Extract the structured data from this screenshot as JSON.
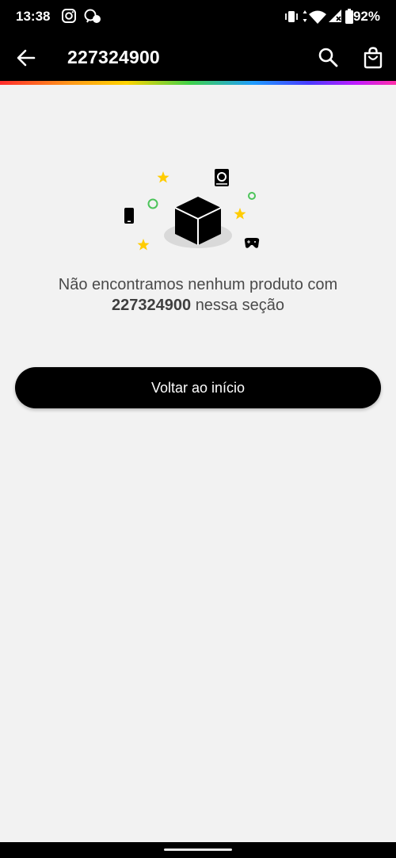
{
  "status_bar": {
    "time": "13:38",
    "battery": "92%",
    "icons": [
      "instagram-icon",
      "whatsapp-icon",
      "vibrate-icon",
      "wifi-icon",
      "signal-icon",
      "battery-icon"
    ]
  },
  "app_bar": {
    "title": "227324900",
    "icons": [
      "back-arrow-icon",
      "search-icon",
      "shopping-bag-icon"
    ]
  },
  "empty_state": {
    "message_prefix": "Não encontramos nenhum produto com",
    "query": "227324900",
    "message_suffix": "nessa seção",
    "illustration_icons": [
      "box-icon",
      "phone-icon",
      "book-icon",
      "gamepad-icon",
      "star-icon",
      "circle-icon"
    ]
  },
  "actions": {
    "back_home_label": "Voltar ao início"
  },
  "colors": {
    "background": "#f2f2f2",
    "bar": "#000000",
    "star": "#ffcc00",
    "circle": "#4cc45a"
  }
}
